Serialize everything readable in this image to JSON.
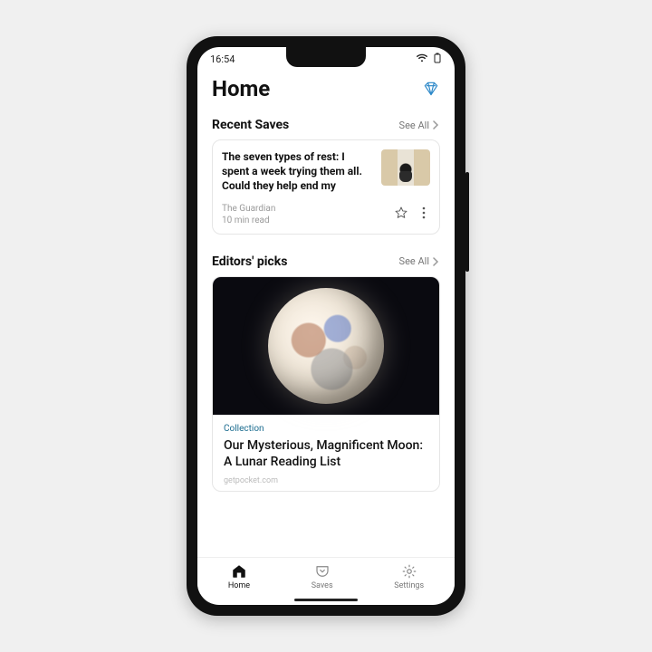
{
  "status": {
    "time": "16:54"
  },
  "header": {
    "title": "Home"
  },
  "recent": {
    "heading": "Recent Saves",
    "see_all": "See All",
    "card": {
      "title": "The seven types of rest: I spent a week trying them all. Could they help end my",
      "source": "The Guardian",
      "read_time": "10 min read"
    }
  },
  "editors": {
    "heading": "Editors' picks",
    "see_all": "See All",
    "card": {
      "tag": "Collection",
      "title": "Our Mysterious, Magnificent Moon: A Lunar Reading List",
      "domain": "getpocket.com"
    }
  },
  "nav": {
    "home": "Home",
    "saves": "Saves",
    "settings": "Settings"
  }
}
